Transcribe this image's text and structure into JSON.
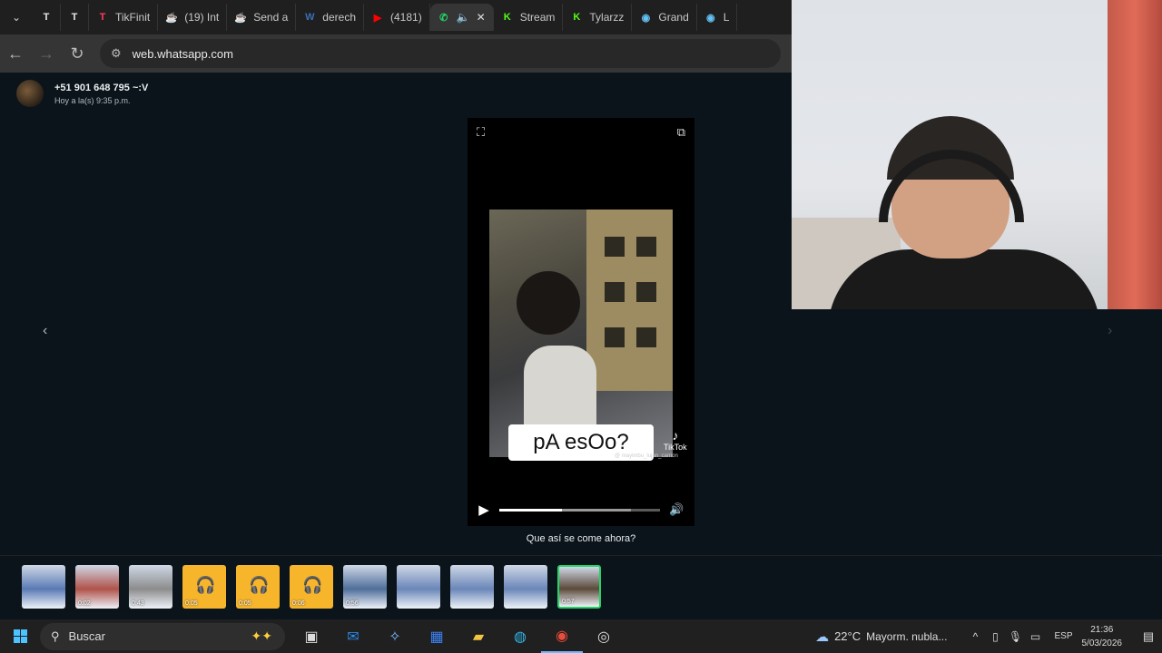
{
  "browser": {
    "tabs": [
      {
        "label": "",
        "icon": "tikfinity-icon",
        "color": "#e8e8e8"
      },
      {
        "label": "",
        "icon": "tikfinity-icon",
        "color": "#e8e8e8"
      },
      {
        "label": "TikFinit",
        "icon": "tikfinity-icon",
        "color": "#ff3b5c"
      },
      {
        "label": "(19) Int",
        "icon": "kofi-icon",
        "color": "#f5a623"
      },
      {
        "label": "Send a",
        "icon": "kofi-icon",
        "color": "#f5a623"
      },
      {
        "label": "derech",
        "icon": "wordpress-icon",
        "color": "#3b6fb6"
      },
      {
        "label": "(4181)",
        "icon": "youtube-icon",
        "color": "#ff0000"
      },
      {
        "label": "",
        "icon": "whatsapp-icon",
        "color": "#25d366",
        "active": true
      },
      {
        "label": "Stream",
        "icon": "kick-icon",
        "color": "#53fc18"
      },
      {
        "label": "Tylarzz",
        "icon": "kick-icon",
        "color": "#53fc18"
      },
      {
        "label": "Grand",
        "icon": "steam-icon",
        "color": "#66c0f4"
      },
      {
        "label": "L",
        "icon": "steam-icon",
        "color": "#66c0f4"
      }
    ],
    "url": "web.whatsapp.com"
  },
  "viewer": {
    "sender_name": "+51 901 648 795 ~:V",
    "sender_time": "Hoy a la(s) 9:35 p.m.",
    "caption_overlay": "pA esOo?",
    "tiktok_label": "TikTok",
    "tiktok_handle": "@ mayimbu_lujan_carrion",
    "message_caption": "Que así se come ahora?",
    "progress": 0.39,
    "buffered_to": 0.82
  },
  "thumbnails": [
    {
      "type": "video",
      "duration": "",
      "color": "#5a7ab5"
    },
    {
      "type": "video",
      "duration": "0:02",
      "color": "#b0524a"
    },
    {
      "type": "video",
      "duration": "0:43",
      "color": "#8c8c8c"
    },
    {
      "type": "audio",
      "duration": "0:05",
      "color": "#f7b52c"
    },
    {
      "type": "audio",
      "duration": "0:05",
      "color": "#f7b52c"
    },
    {
      "type": "audio",
      "duration": "0:06",
      "color": "#f7b52c"
    },
    {
      "type": "video",
      "duration": "0:56",
      "color": "#4f6e9a"
    },
    {
      "type": "image",
      "duration": "",
      "color": "#6a86b8"
    },
    {
      "type": "image",
      "duration": "",
      "color": "#6a86b8"
    },
    {
      "type": "image",
      "duration": "",
      "color": "#6a86b8"
    },
    {
      "type": "video",
      "duration": "0:57",
      "color": "#5b4a3a",
      "selected": true
    }
  ],
  "taskbar": {
    "search_placeholder": "Buscar",
    "apps": [
      "task-view-icon",
      "outlook-icon",
      "copilot-icon",
      "store-icon",
      "file-explorer-icon",
      "edge-icon",
      "chrome-icon",
      "obs-icon"
    ],
    "temperature": "22°C",
    "weather": "Mayorm. nubla...",
    "language": "ESP",
    "time": "21:36",
    "date": "5/03/2026"
  }
}
